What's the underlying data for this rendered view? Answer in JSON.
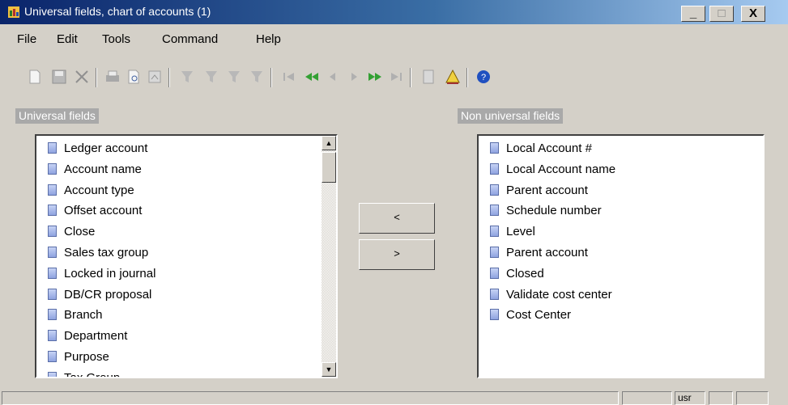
{
  "window": {
    "title": "Universal fields, chart of accounts (1)",
    "buttons": {
      "minimize": "_",
      "maximize": "□",
      "close": "X"
    }
  },
  "menubar": [
    "File",
    "Edit",
    "Tools",
    "Command",
    "Help"
  ],
  "toolbar": {
    "icons": [
      "new-icon",
      "save-icon",
      "delete-icon",
      "print-icon",
      "print-preview-icon",
      "report-icon",
      "filter-icon",
      "filter-by-selection-icon",
      "advanced-filter-icon",
      "clear-filter-icon",
      "first-record-icon",
      "previous-page-icon",
      "previous-record-icon",
      "next-record-icon",
      "next-page-icon",
      "last-record-icon",
      "document-icon",
      "alert-icon",
      "help-icon"
    ]
  },
  "universal_fields": {
    "label": "Universal fields",
    "items": [
      "Ledger account",
      "Account name",
      "Account type",
      "Offset account",
      "Close",
      "Sales tax group",
      "Locked in journal",
      "DB/CR proposal",
      "Branch",
      "Department",
      "Purpose",
      "Tax Group"
    ]
  },
  "non_universal_fields": {
    "label": "Non universal fields",
    "items": [
      "Local Account #",
      "Local Account name",
      "Parent account",
      "Schedule number",
      "Level",
      "Parent account",
      "Closed",
      "Validate cost center",
      "Cost Center"
    ]
  },
  "move_buttons": {
    "left": "<",
    "right": ">"
  },
  "statusbar": {
    "user": "usr"
  }
}
